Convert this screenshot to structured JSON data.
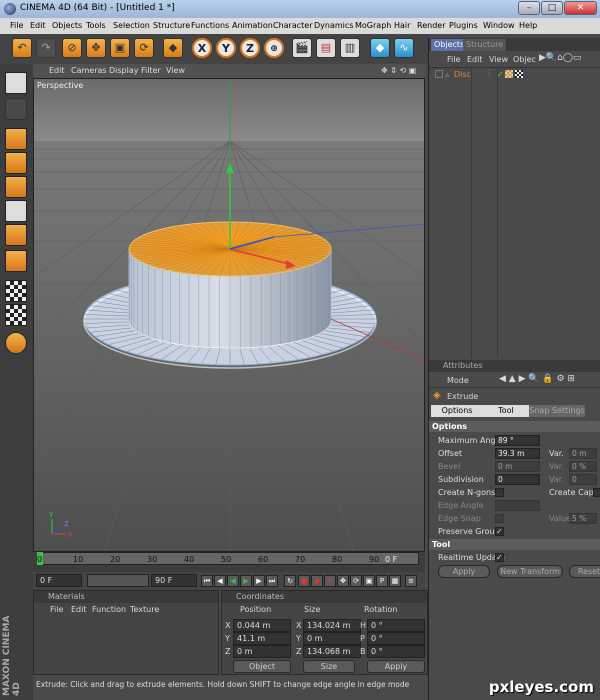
{
  "window": {
    "title": "CINEMA 4D (64 Bit) - [Untitled 1 *]",
    "min": "–",
    "max": "□",
    "close": "✕"
  },
  "menu": [
    "File",
    "Edit",
    "Objects",
    "Tools",
    "Selection",
    "Structure",
    "Functions",
    "Animation",
    "Character",
    "Dynamics",
    "MoGraph",
    "Hair",
    "Render",
    "Plugins",
    "Window",
    "Help"
  ],
  "toolbar": {
    "axis_x": "X",
    "axis_y": "Y",
    "axis_z": "Z"
  },
  "viewport": {
    "menu": [
      "Edit",
      "Cameras",
      "Display",
      "Filter",
      "View"
    ],
    "label": "Perspective",
    "nav_icons": "✥ ⇕ ⟲ ▣"
  },
  "timeline": {
    "ticks": [
      "0",
      "10",
      "20",
      "30",
      "40",
      "50",
      "60",
      "70",
      "80",
      "90"
    ],
    "frame_label": "0 F",
    "start": "0 F",
    "end": "90 F",
    "current": "0 F"
  },
  "materials": {
    "title": "Materials",
    "menu": [
      "File",
      "Edit",
      "Function",
      "Texture"
    ]
  },
  "coordinates": {
    "title": "Coordinates",
    "headers": [
      "Position",
      "Size",
      "Rotation"
    ],
    "rows": [
      {
        "axis": "X",
        "pos": "0.044 m",
        "size": "134.024 m",
        "rot_axis": "H",
        "rot": "0 °"
      },
      {
        "axis": "Y",
        "pos": "41.1 m",
        "size": "0 m",
        "rot_axis": "P",
        "rot": "0 °"
      },
      {
        "axis": "Z",
        "pos": "0 m",
        "size": "134.068 m",
        "rot_axis": "B",
        "rot": "0 °"
      }
    ],
    "mode_select": "Object",
    "size_select": "Size",
    "apply": "Apply"
  },
  "status": "Extrude: Click and drag to extrude elements. Hold down SHIFT to change edge angle in edge mode",
  "objects": {
    "tabs": [
      "Objects",
      "Structure"
    ],
    "menu": [
      "File",
      "Edit",
      "View",
      "Objec"
    ],
    "items": [
      {
        "name": "Disc"
      }
    ]
  },
  "attributes": {
    "title": "Attributes",
    "mode": "Mode",
    "tool_name": "Extrude",
    "tabs": [
      "Options",
      "Tool",
      "Snap Settings"
    ],
    "section_options": "Options",
    "max_angle_label": "Maximum Angle",
    "max_angle": "89 °",
    "offset_label": "Offset",
    "offset": "39.3 m",
    "var_label": "Var.",
    "var1": "0 m",
    "var2": "0 %",
    "bevel_label": "Bevel",
    "bevel": "0 m",
    "subdivision_label": "Subdivision",
    "subdivision": "0",
    "var3": "0",
    "create_ngons": "Create N-gons",
    "create_caps": "Create Caps",
    "edge_angle": "Edge Angle",
    "edge_snap": "Edge Snap",
    "value_label": "Value",
    "value": "5 %",
    "preserve_groups": "Preserve Groups",
    "section_tool": "Tool",
    "realtime_update": "Realtime Update",
    "apply": "Apply",
    "new_transform": "New Transform",
    "reset": "Reset"
  },
  "branding": {
    "maxon": "MAXON CINEMA 4D",
    "watermark": "pxleyes.com"
  }
}
